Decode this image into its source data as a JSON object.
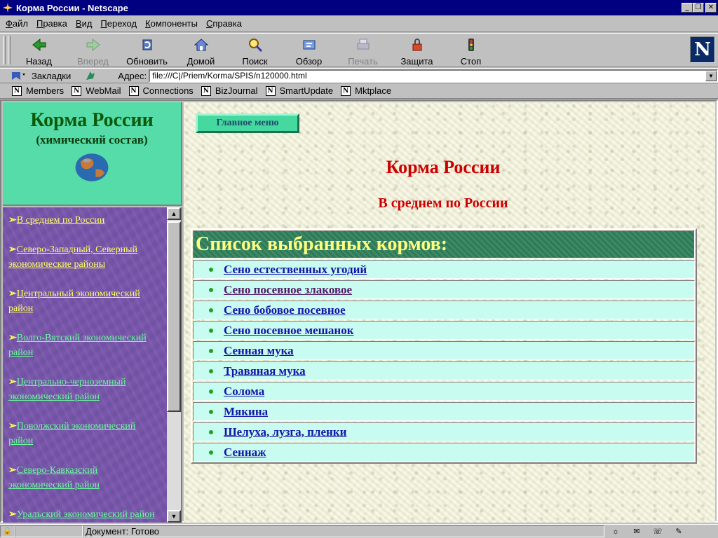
{
  "window": {
    "title": "Корма России - Netscape"
  },
  "menubar": [
    {
      "u": "Ф",
      "rest": "айл"
    },
    {
      "u": "П",
      "rest": "равка"
    },
    {
      "u": "В",
      "rest": "ид"
    },
    {
      "u": "П",
      "rest": "ереход"
    },
    {
      "u": "К",
      "rest": "омпоненты"
    },
    {
      "u": "С",
      "rest": "правка"
    }
  ],
  "toolbar": {
    "back": "Назад",
    "forward": "Вперед",
    "reload": "Обновить",
    "home": "Домой",
    "search": "Поиск",
    "browse": "Обзор",
    "print": "Печать",
    "security": "Защита",
    "stop": "Стоп"
  },
  "location": {
    "bookmarks_label": "Закладки",
    "address_label": "Адрес:",
    "url": "file:///C|/Priem/Korma/SPIS/n120000.html"
  },
  "personal_bar": [
    "Members",
    "WebMail",
    "Connections",
    "BizJournal",
    "SmartUpdate",
    "Mktplace"
  ],
  "left_header": {
    "title": "Корма России",
    "subtitle": "(химический состав)"
  },
  "left_nav": [
    {
      "label": "В среднем по России",
      "visited": false
    },
    {
      "label": "Северо-Западный, Северный экономические районы",
      "visited": false
    },
    {
      "label": "Центральный экономический район",
      "visited": false
    },
    {
      "label": "Волго-Вятский экономический район",
      "visited": true
    },
    {
      "label": "Центрально-черноземный экономический район",
      "visited": true
    },
    {
      "label": "Поволжский экономический район",
      "visited": true
    },
    {
      "label": "Северо-Кавказский экономический район",
      "visited": true
    },
    {
      "label": "Уральский экономический район",
      "visited": true
    }
  ],
  "main": {
    "menu_button": "Главное меню",
    "title": "Корма России",
    "subtitle": "В среднем по России",
    "list_header": "Список выбранных кормов:",
    "feeds": [
      {
        "label": "Сено естественных угодий",
        "visited": false
      },
      {
        "label": "Сено посевное злаковое",
        "visited": true
      },
      {
        "label": "Сено бобовое посевное",
        "visited": false
      },
      {
        "label": "Сено посевное мешанок",
        "visited": false
      },
      {
        "label": "Сенная мука",
        "visited": false
      },
      {
        "label": "Травяная мука",
        "visited": false
      },
      {
        "label": "Солома",
        "visited": false
      },
      {
        "label": "Мякина",
        "visited": false
      },
      {
        "label": "Шелуха, лузга, пленки",
        "visited": false
      },
      {
        "label": "Сеннаж",
        "visited": false
      }
    ]
  },
  "status": {
    "text": "Документ: Готово"
  },
  "colors": {
    "titlebar": "#000080",
    "page_title": "#cc0000",
    "left_header_bg": "#55dca8",
    "link_yellow": "#ffff66",
    "link_visited_green": "#66ff99",
    "feed_link": "#1414a8"
  }
}
